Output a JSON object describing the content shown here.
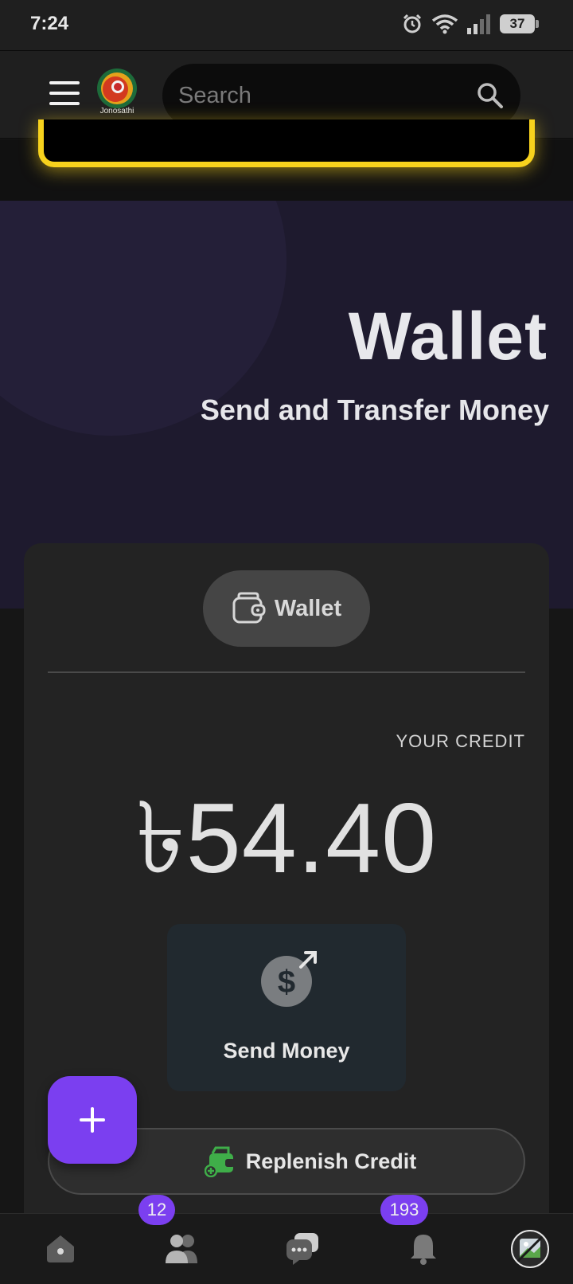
{
  "status_bar": {
    "time": "7:24",
    "battery": "37"
  },
  "header": {
    "logo_text": "Jonosathi",
    "search_placeholder": "Search"
  },
  "hero": {
    "title": "Wallet",
    "subtitle": "Send and Transfer Money"
  },
  "wallet": {
    "tab_label": "Wallet",
    "credit_label": "YOUR CREDIT",
    "credit_amount": "৳54.40",
    "send_money_label": "Send Money",
    "replenish_label": "Replenish Credit"
  },
  "bottom_nav": {
    "friends_badge": "12",
    "notifications_badge": "193"
  },
  "colors": {
    "accent": "#7b3ff0",
    "banner_glow": "#f7d21d",
    "hero_bg": "#1e1a2e",
    "replenish_icon": "#3fae49"
  }
}
